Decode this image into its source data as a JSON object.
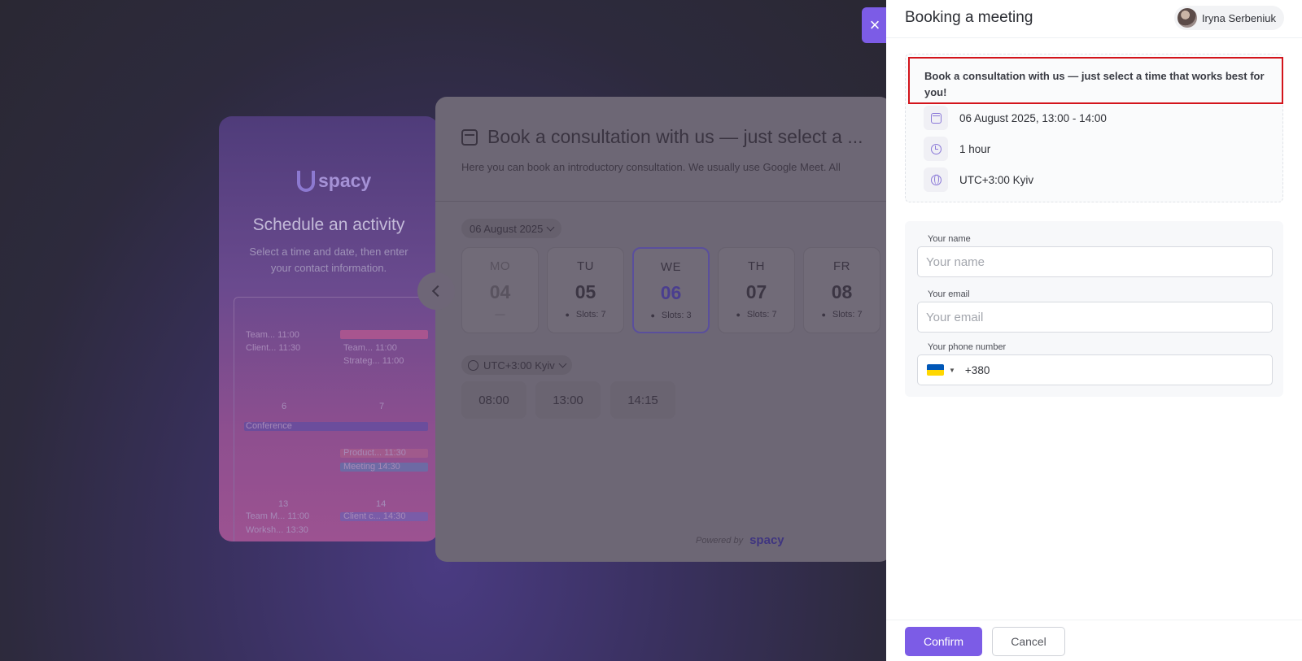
{
  "background": {
    "scheduler_card": {
      "logo": "spacy",
      "title": "Schedule an activity",
      "subtitle": "Select a time and date, then enter your contact information.",
      "calendar": {
        "day_numbers": [
          "6",
          "7",
          "13",
          "14"
        ],
        "events": [
          {
            "title": "Team...",
            "time": "11:00"
          },
          {
            "title": "Client...",
            "time": "11:30"
          },
          {
            "title": "Team...",
            "time": "11:00"
          },
          {
            "title": "Strateg...",
            "time": "11:00"
          },
          {
            "title": "Conference",
            "time": ""
          },
          {
            "title": "Product...",
            "time": "11:30"
          },
          {
            "title": "Meeting",
            "time": "14:30"
          },
          {
            "title": "Team M...",
            "time": "11:00"
          },
          {
            "title": "Client c...",
            "time": "14:30"
          },
          {
            "title": "Worksh...",
            "time": "13:30"
          }
        ]
      }
    },
    "booking_modal": {
      "title": "Book a consultation with us — just select a ...",
      "description": "Here you can book an introductory consultation. We usually use Google Meet. All",
      "date_selector": "06 August 2025",
      "days": [
        {
          "name": "MO",
          "date": "04",
          "slots": "—",
          "state": "disabled"
        },
        {
          "name": "TU",
          "date": "05",
          "slots": "Slots: 7",
          "state": "normal"
        },
        {
          "name": "WE",
          "date": "06",
          "slots": "Slots: 3",
          "state": "selected"
        },
        {
          "name": "TH",
          "date": "07",
          "slots": "Slots: 7",
          "state": "normal"
        },
        {
          "name": "FR",
          "date": "08",
          "slots": "Slots: 7",
          "state": "normal"
        }
      ],
      "timezone": "UTC+3:00 Kyiv",
      "time_slots": [
        "08:00",
        "13:00",
        "14:15"
      ],
      "powered_by": "Powered by",
      "powered_brand": "spacy"
    }
  },
  "close_icon": "×",
  "panel": {
    "title": "Booking a meeting",
    "user_name": "Iryna Serbeniuk",
    "summary": {
      "headline": "Book a consultation with us — just select a time that works best for you!",
      "datetime": "06 August 2025, 13:00 - 14:00",
      "duration": "1 hour",
      "timezone": "UTC+3:00 Kyiv"
    },
    "form": {
      "name_label": "Your name",
      "name_placeholder": "Your name",
      "email_label": "Your email",
      "email_placeholder": "Your email",
      "phone_label": "Your phone number",
      "phone_value": "+380",
      "flag_colors": [
        "#0057B7",
        "#FFD700"
      ]
    },
    "footer": {
      "confirm_label": "Confirm",
      "cancel_label": "Cancel"
    }
  },
  "colors": {
    "accent": "#7c5ce6",
    "highlight_border": "#d3141b"
  }
}
